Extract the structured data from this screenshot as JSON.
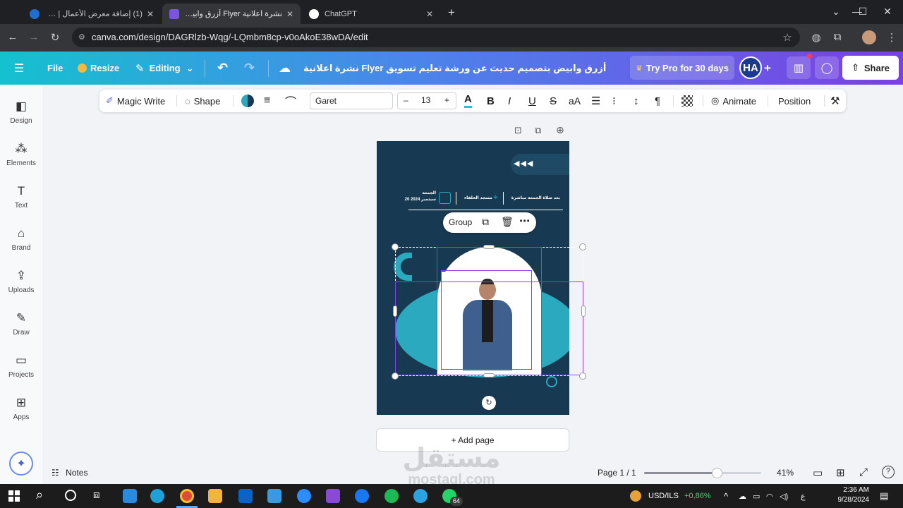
{
  "browser": {
    "tabs": [
      {
        "title": "(1) إضافة معرض الأعمال | مستقل",
        "active": false,
        "favicon_color": "#1f6fd1"
      },
      {
        "title": "نشرة اعلانية Flyer أزرق وابيض بتـ",
        "active": true,
        "favicon_color": "#7a55e0"
      },
      {
        "title": "ChatGPT",
        "active": false,
        "favicon_color": "#ffffff"
      }
    ],
    "new_tab": "+",
    "url": "canva.com/design/DAGRlzb-Wqg/-LQmbm8cp-v0oAkoE38wDA/edit"
  },
  "header": {
    "file": "File",
    "resize": "Resize",
    "editing": "Editing",
    "doc_title": "أزرق وابيض بتصميم حديث عن ورشة تعليم تسويق Flyer نشرة اعلانية",
    "try_pro": "Try Pro for 30 days",
    "avatar": "HA",
    "share": "Share"
  },
  "sidebar": {
    "items": [
      {
        "label": "Design",
        "icon": "design-icon",
        "glyph": "◧"
      },
      {
        "label": "Elements",
        "icon": "elements-icon",
        "glyph": "⁂"
      },
      {
        "label": "Text",
        "icon": "text-icon",
        "glyph": "T"
      },
      {
        "label": "Brand",
        "icon": "brand-icon",
        "glyph": "⌂"
      },
      {
        "label": "Uploads",
        "icon": "uploads-icon",
        "glyph": "⇪"
      },
      {
        "label": "Draw",
        "icon": "draw-icon",
        "glyph": "✎"
      },
      {
        "label": "Projects",
        "icon": "projects-icon",
        "glyph": "▭"
      },
      {
        "label": "Apps",
        "icon": "apps-icon",
        "glyph": "⊞"
      }
    ]
  },
  "toolbar": {
    "magic_write": "Magic Write",
    "shape": "Shape",
    "font": "Garet",
    "font_size": "13",
    "minus": "–",
    "plus": "+",
    "animate": "Animate",
    "position": "Position"
  },
  "canvas": {
    "event_day": "الجمعة",
    "event_date": "20 سبتمبر 2024",
    "venue": "مسجد الخلفاء",
    "time_note": "بعد صلاة الجمعة مباشرة",
    "group_label": "Group",
    "add_page": "+ Add page",
    "colors": {
      "bg": "#173a52",
      "accent": "#2aa9bf"
    }
  },
  "status": {
    "notes": "Notes",
    "page": "Page 1 / 1",
    "zoom": "41%",
    "zoom_level": 0.41
  },
  "taskbar": {
    "ticker": "USD/ILS",
    "ticker_change": "+0,86%",
    "lang": "ع",
    "time": "2:36 AM",
    "date": "9/28/2024",
    "whatsapp_badge": "64"
  },
  "watermark": {
    "arabic": "مستقل",
    "latin": "mostaql.com"
  }
}
